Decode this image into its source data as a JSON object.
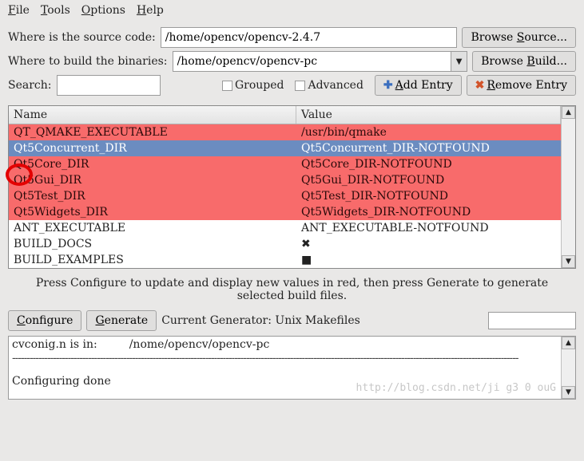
{
  "menu": {
    "file": "File",
    "tools": "Tools",
    "options": "Options",
    "help": "Help"
  },
  "source": {
    "label": "Where is the source code:",
    "value": "/home/opencv/opencv-2.4.7",
    "browse": "Browse Source..."
  },
  "build": {
    "label": "Where to build the binaries:",
    "value": "/home/opencv/opencv-pc",
    "browse": "Browse Build..."
  },
  "search": {
    "label": "Search:",
    "value": ""
  },
  "options": {
    "grouped": "Grouped",
    "advanced": "Advanced",
    "add": "Add Entry",
    "remove": "Remove Entry"
  },
  "table": {
    "head_name": "Name",
    "head_value": "Value",
    "rows": [
      {
        "name": "QT_QMAKE_EXECUTABLE",
        "value": "/usr/bin/qmake",
        "cls": "red"
      },
      {
        "name": "Qt5Concurrent_DIR",
        "value": "Qt5Concurrent_DIR-NOTFOUND",
        "cls": "selected"
      },
      {
        "name": "Qt5Core_DIR",
        "value": "Qt5Core_DIR-NOTFOUND",
        "cls": "red"
      },
      {
        "name": "Qt5Gui_DIR",
        "value": "Qt5Gui_DIR-NOTFOUND",
        "cls": "red"
      },
      {
        "name": "Qt5Test_DIR",
        "value": "Qt5Test_DIR-NOTFOUND",
        "cls": "red"
      },
      {
        "name": "Qt5Widgets_DIR",
        "value": "Qt5Widgets_DIR-NOTFOUND",
        "cls": "red"
      },
      {
        "name": "ANT_EXECUTABLE",
        "value": "ANT_EXECUTABLE-NOTFOUND",
        "cls": "white"
      },
      {
        "name": "BUILD_DOCS",
        "value": "✖",
        "cls": "white"
      },
      {
        "name": "BUILD_EXAMPLES",
        "value": "■",
        "cls": "white"
      }
    ]
  },
  "hint": "Press Configure to update and display new values in red, then press Generate to generate selected build files.",
  "buttons": {
    "configure": "Configure",
    "generate": "Generate"
  },
  "generator": "Current Generator: Unix Makefiles",
  "log": {
    "line1": "cvconig.n is in:",
    "line1b": "/nome/opencv/opencv-pc",
    "line2": "Configuring done"
  },
  "watermark": "http://blog.csdn.net/ji g3 0 ouG"
}
